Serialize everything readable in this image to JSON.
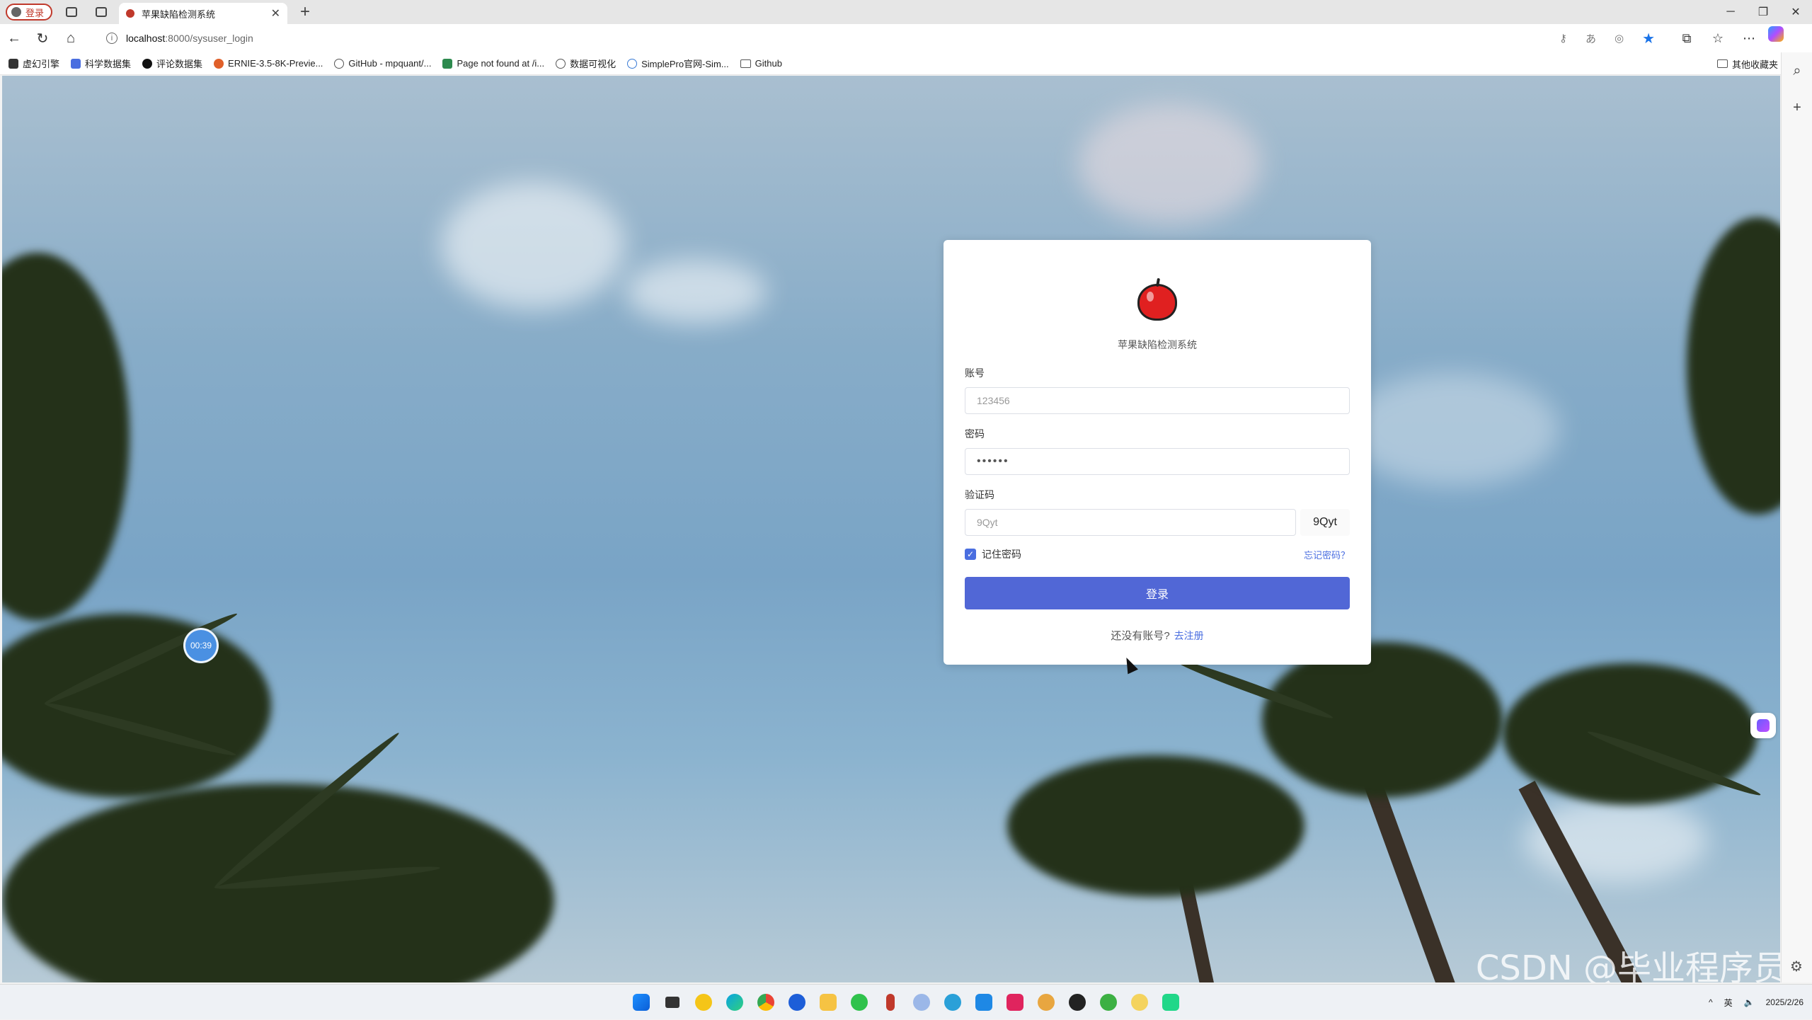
{
  "browser": {
    "profile_label": "登录",
    "tab_title": "苹果缺陷检测系统",
    "url_host": "localhost",
    "url_path": ":8000/sysuser_login",
    "win_min": "─",
    "win_max": "❐",
    "win_close": "✕"
  },
  "bookmarks": [
    {
      "label": "虚幻引擎",
      "color": "#333333"
    },
    {
      "label": "科学数据集",
      "color": "#4a6ee0"
    },
    {
      "label": "评论数据集",
      "color": "#111111"
    },
    {
      "label": "ERNIE-3.5-8K-Previe...",
      "color": "#e0602a"
    },
    {
      "label": "GitHub - mpquant/...",
      "color": "#555555"
    },
    {
      "label": "Page not found at /i...",
      "color": "#2d8a4e"
    },
    {
      "label": "数据可视化",
      "color": "#555555"
    },
    {
      "label": "SimplePro官网-Sim...",
      "color": "#3a7bd5"
    },
    {
      "label": "Github",
      "color": "#555555"
    }
  ],
  "bookmarks_other": "其他收藏夹",
  "page": {
    "timer": "00:39",
    "watermark": "CSDN @毕业程序员"
  },
  "login": {
    "system_name": "苹果缺陷检测系统",
    "account_label": "账号",
    "account_value": "123456",
    "password_label": "密码",
    "password_value": "••••••",
    "captcha_label": "验证码",
    "captcha_value": "9Qyt",
    "captcha_image_text": "9Qyt",
    "remember_label": "记住密码",
    "remember_checked": true,
    "forgot_label": "忘记密码？",
    "login_button": "登录",
    "no_account_text": "还没有账号?",
    "register_link": "去注册"
  },
  "taskbar": {
    "date": "2025/2/26",
    "tray_lang": "英"
  },
  "colors": {
    "primary": "#5167d6",
    "link": "#4a6ee0",
    "apple": "#e02020"
  }
}
